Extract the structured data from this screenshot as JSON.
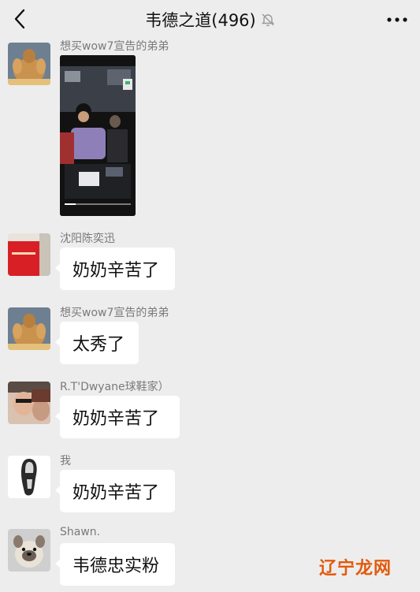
{
  "header": {
    "title": "韦德之道(496)",
    "back_icon": "chevron-left-icon",
    "mute_icon": "bell-off-icon",
    "more_icon": "more-dots-icon"
  },
  "messages": [
    {
      "sender": "想买wow7宣告的弟弟",
      "type": "video",
      "avatar": "muscle-avatar"
    },
    {
      "sender": "沈阳陈奕迅",
      "text": "奶奶辛苦了",
      "avatar": "red-shirt-avatar"
    },
    {
      "sender": "想买wow7宣告的弟弟",
      "text": "太秀了",
      "avatar": "muscle-avatar"
    },
    {
      "sender": "R.T'Dwyane球鞋家）",
      "text": "奶奶辛苦了",
      "avatar": "selfie-avatar"
    },
    {
      "sender": "我",
      "text": "奶奶辛苦了",
      "avatar": "shoe-sole-avatar"
    },
    {
      "sender": "Shawn.",
      "text": "韦德忠实粉",
      "avatar": "dog-avatar"
    }
  ],
  "watermark": "辽宁龙网",
  "colors": {
    "background": "#ededed",
    "bubble": "#ffffff",
    "sender_text": "#7a7a7a",
    "watermark": "#e25a0b"
  }
}
